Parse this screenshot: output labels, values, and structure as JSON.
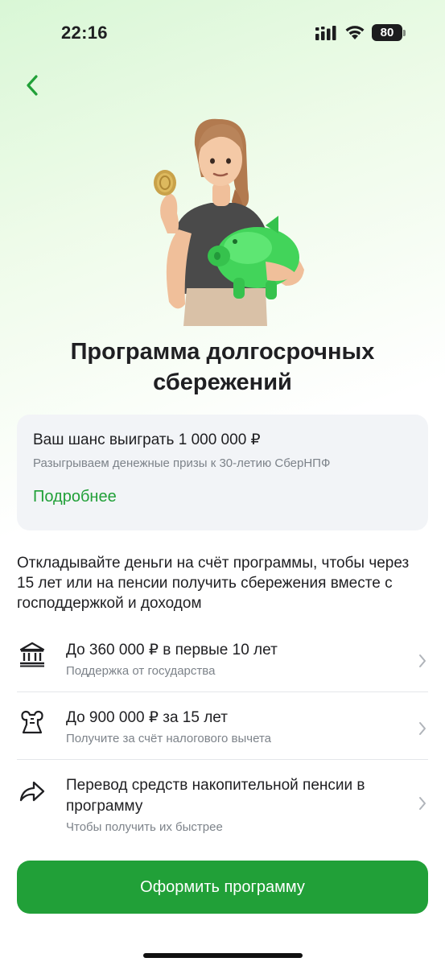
{
  "status_bar": {
    "time": "22:16",
    "battery": "80",
    "icons": [
      "signal-icon",
      "wifi-icon",
      "battery-icon"
    ]
  },
  "header": {
    "back_icon": "chevron-left-icon"
  },
  "hero": {
    "illustration": "woman-with-coin-and-piggy-bank"
  },
  "title": "Программа долгосрочных сбережений",
  "promo": {
    "title": "Ваш шанс выиграть 1 000 000 ₽",
    "subtitle": "Разыгрываем денежные призы к 30-летию СберНПФ",
    "link": "Подробнее"
  },
  "description": "Откладывайте деньги на счёт программы, чтобы через 15 лет или на пенсии получить сбережения вместе с господдержкой и доходом",
  "benefits": [
    {
      "icon": "bank-icon",
      "title": "До 360 000 ₽ в первые 10 лет",
      "subtitle": "Поддержка от государства"
    },
    {
      "icon": "tax-deduction-icon",
      "title": "До 900 000 ₽ за 15 лет",
      "subtitle": "Получите за счёт налогового вычета"
    },
    {
      "icon": "transfer-arrow-icon",
      "title": "Перевод средств накопительной пенсии в программу",
      "subtitle": "Чтобы получить их быстрее"
    }
  ],
  "primary_button": "Оформить программу",
  "colors": {
    "accent": "#21a038",
    "text": "#1f1f22",
    "secondary_text": "#7d838a",
    "card_bg": "#f2f4f7"
  }
}
